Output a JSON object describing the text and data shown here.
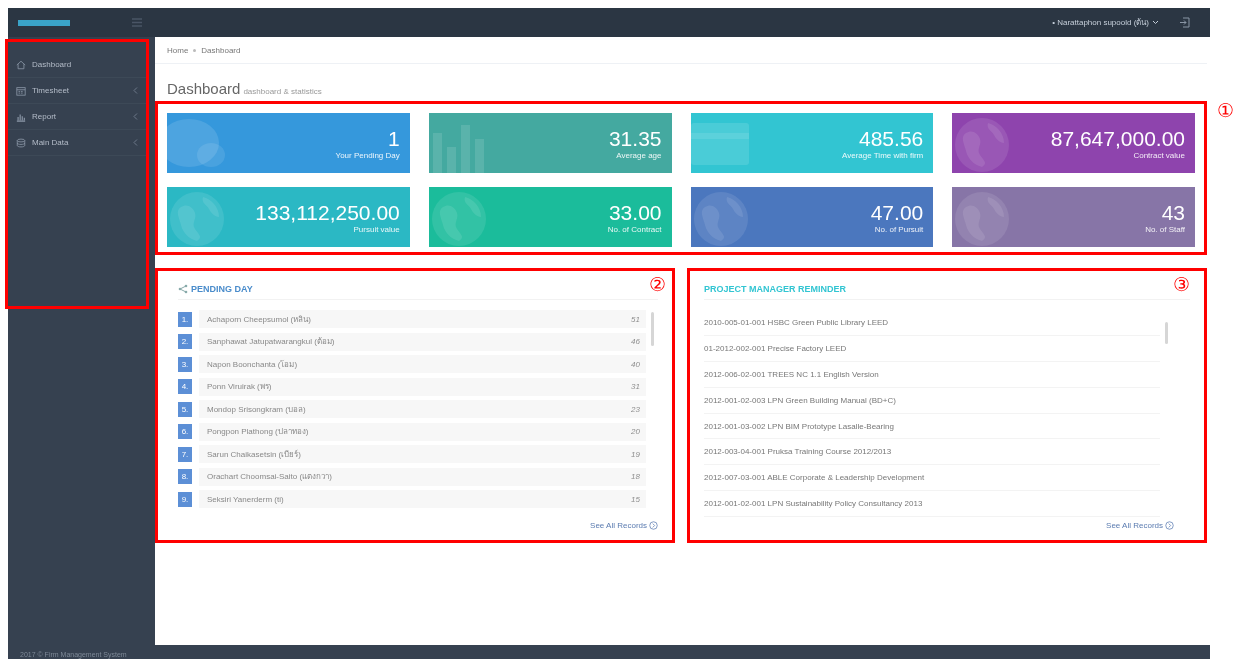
{
  "topbar": {
    "user": "• Narattaphon supoold (ต้น)"
  },
  "sidebar": {
    "items": [
      {
        "label": "Dashboard",
        "kind": "home",
        "has_submenu": false
      },
      {
        "label": "Timesheet",
        "kind": "calendar",
        "has_submenu": true
      },
      {
        "label": "Report",
        "kind": "chart",
        "has_submenu": true
      },
      {
        "label": "Main Data",
        "kind": "database",
        "has_submenu": true
      }
    ]
  },
  "breadcrumb": [
    "Home",
    "Dashboard"
  ],
  "page_title": "Dashboard",
  "page_subtitle": "dashboard & statistics",
  "stats": [
    {
      "value": "1",
      "label": "Your Pending Day",
      "color": "#3598dc",
      "kind": "bubble"
    },
    {
      "value": "31.35",
      "label": "Average age",
      "color": "#44a9a0",
      "kind": "bars"
    },
    {
      "value": "485.56",
      "label": "Average Time with firm",
      "color": "#32c5d2",
      "kind": "card"
    },
    {
      "value": "87,647,000.00",
      "label": "Contract value",
      "color": "#8e44ad",
      "kind": "globe"
    },
    {
      "value": "133,112,250.00",
      "label": "Pursuit value",
      "color": "#2bb8c4",
      "kind": "globe"
    },
    {
      "value": "33.00",
      "label": "No. of Contract",
      "color": "#1bbc9b",
      "kind": "globe"
    },
    {
      "value": "47.00",
      "label": "No. of Pursuit",
      "color": "#4b77be",
      "kind": "globe"
    },
    {
      "value": "43",
      "label": "No. of Staff",
      "color": "#8775a7",
      "kind": "globe"
    }
  ],
  "pending_day": {
    "title": "PENDING DAY",
    "rows": [
      {
        "rank": "1.",
        "name": "Achaporn Cheepsumol (หลิน)",
        "days": "51"
      },
      {
        "rank": "2.",
        "name": "Sanphawat Jatupatwarangkul (ต้อม)",
        "days": "46"
      },
      {
        "rank": "3.",
        "name": "Napon Boonchanta (โอม)",
        "days": "40"
      },
      {
        "rank": "4.",
        "name": "Ponn Viruirak (พร)",
        "days": "31"
      },
      {
        "rank": "5.",
        "name": "Mondop Srisongkram (บอล)",
        "days": "23"
      },
      {
        "rank": "6.",
        "name": "Pongpon Plathong (ปลาทอง)",
        "days": "20"
      },
      {
        "rank": "7.",
        "name": "Sarun Chaikasetsin (เบียร์)",
        "days": "19"
      },
      {
        "rank": "8.",
        "name": "Orachart Choomsai-Saito (แตงกวา)",
        "days": "18"
      },
      {
        "rank": "9.",
        "name": "Seksiri Yanerderm (ti)",
        "days": "15"
      }
    ],
    "link": "See All Records"
  },
  "reminder": {
    "title": "PROJECT MANAGER REMINDER",
    "rows": [
      "2010-005-01-001 HSBC Green Public Library LEED",
      "01-2012-002-001 Precise Factory LEED",
      "2012-006-02-001 TREES NC 1.1 English Version",
      "2012-001-02-003 LPN Green Building Manual (BD+C)",
      "2012-001-03-002 LPN BIM Prototype Lasalle-Bearing",
      "2012-003-04-001 Pruksa Training Course 2012/2013",
      "2012-007-03-001 ABLE Corporate & Leadership Development",
      "2012-001-02-001 LPN Sustainability Policy Consultancy 2013"
    ],
    "link": "See All Records"
  },
  "annotations": [
    "①",
    "②",
    "③"
  ],
  "footer": "2017 © Firm Management System"
}
